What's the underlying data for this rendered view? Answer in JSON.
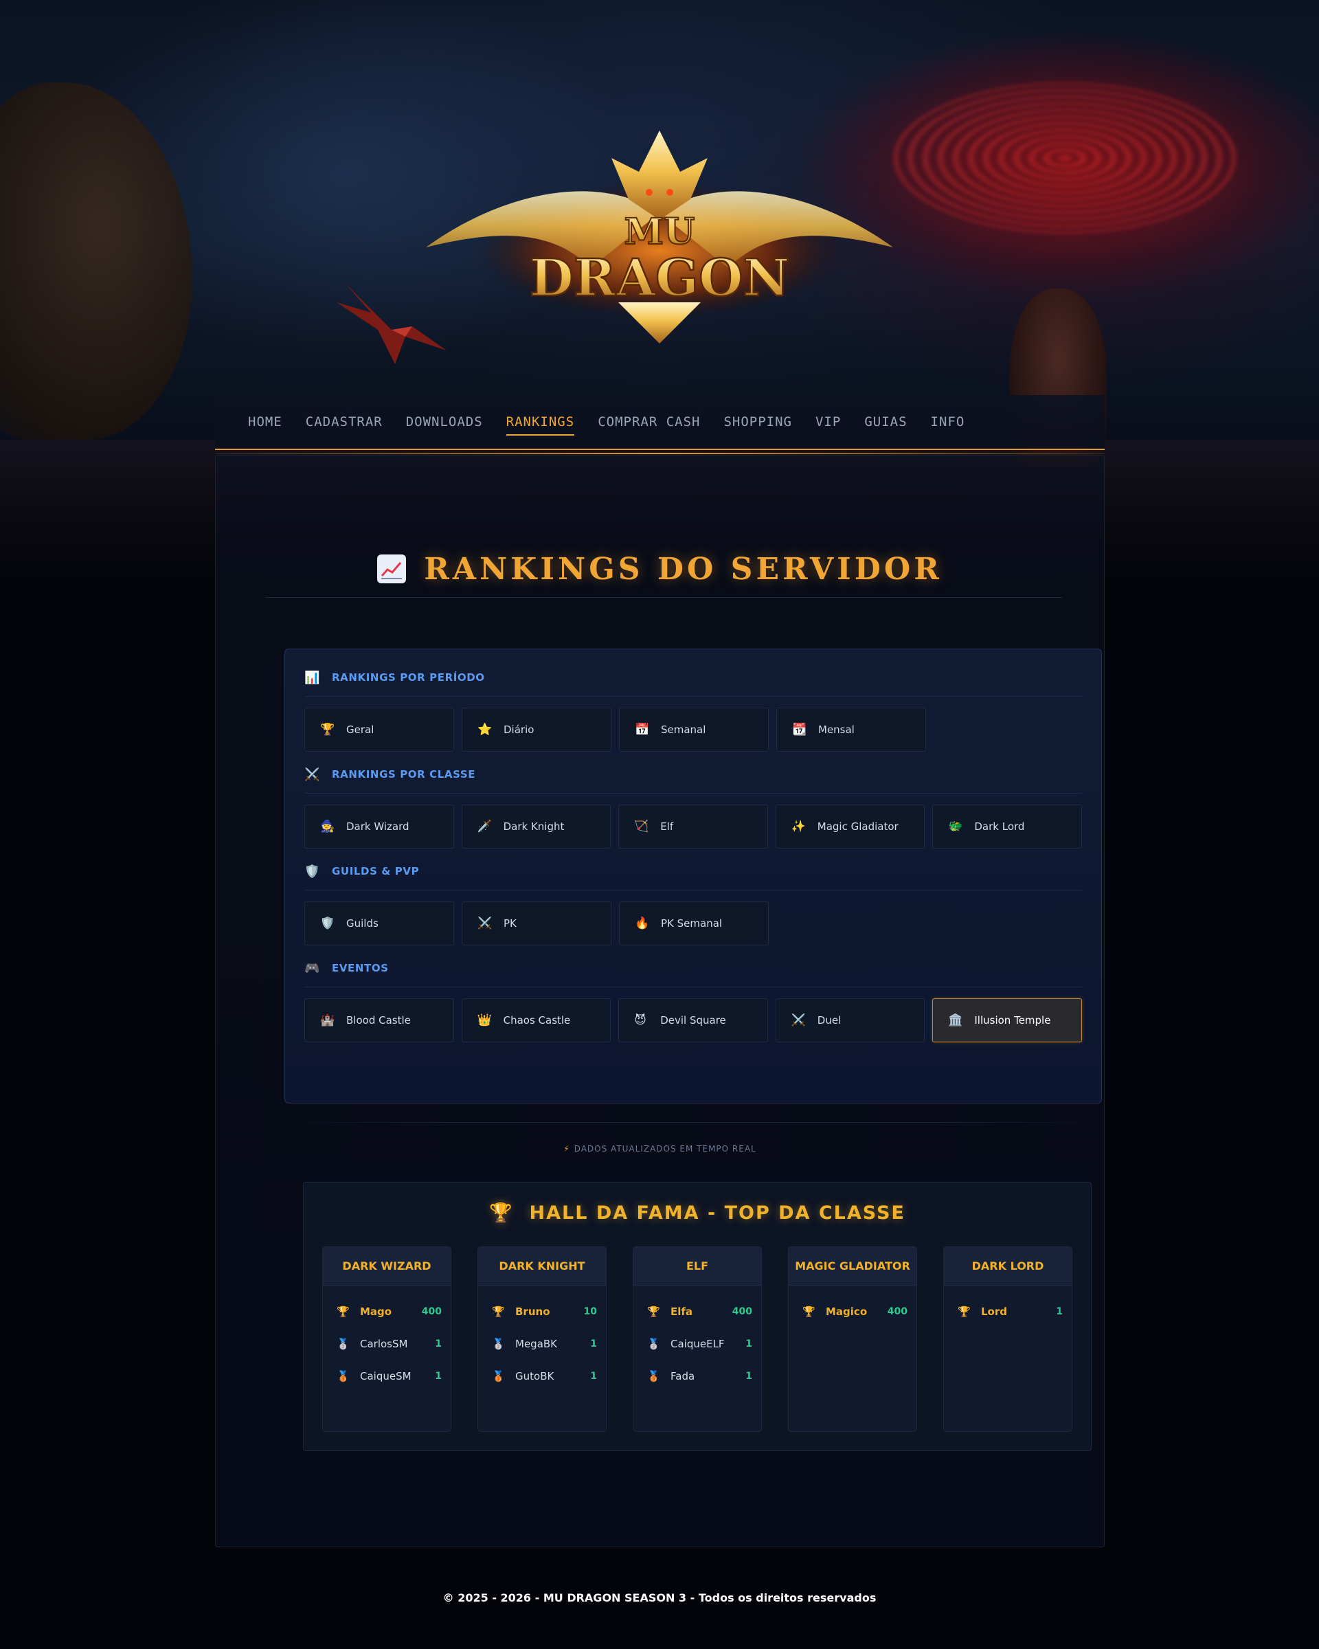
{
  "brand": {
    "logo_line1": "MU",
    "logo_line2": "DRAGON"
  },
  "nav": {
    "items": [
      {
        "label": "HOME"
      },
      {
        "label": "CADASTRAR"
      },
      {
        "label": "DOWNLOADS"
      },
      {
        "label": "RANKINGS",
        "active": true
      },
      {
        "label": "COMPRAR CASH"
      },
      {
        "label": "SHOPPING"
      },
      {
        "label": "VIP"
      },
      {
        "label": "GUIAS"
      },
      {
        "label": "INFO"
      }
    ]
  },
  "page": {
    "title_icon": "chart-up-icon",
    "title": "RANKINGS DO SERVIDOR"
  },
  "categories": {
    "sections": [
      {
        "icon": "📊",
        "icon_name": "bar-chart-icon",
        "label": "RANKINGS POR PERÍODO",
        "buttons": [
          {
            "icon": "🏆",
            "icon_name": "trophy-icon",
            "label": "Geral"
          },
          {
            "icon": "⭐",
            "icon_name": "star-icon",
            "label": "Diário"
          },
          {
            "icon": "📅",
            "icon_name": "calendar-icon",
            "label": "Semanal"
          },
          {
            "icon": "📆",
            "icon_name": "calendar-month-icon",
            "label": "Mensal"
          }
        ]
      },
      {
        "icon": "⚔️",
        "icon_name": "crossed-swords-icon",
        "label": "RANKINGS POR CLASSE",
        "buttons": [
          {
            "icon": "🧙",
            "icon_name": "wizard-icon",
            "label": "Dark Wizard"
          },
          {
            "icon": "🗡️",
            "icon_name": "dagger-icon",
            "label": "Dark Knight"
          },
          {
            "icon": "🏹",
            "icon_name": "bow-arrow-icon",
            "label": "Elf"
          },
          {
            "icon": "✨",
            "icon_name": "sparkles-icon",
            "label": "Magic Gladiator"
          },
          {
            "icon": "🐲",
            "icon_name": "dragon-icon",
            "label": "Dark Lord"
          }
        ]
      },
      {
        "icon": "🛡️",
        "icon_name": "shield-icon",
        "label": "GUILDS & PVP",
        "buttons": [
          {
            "icon": "🛡️",
            "icon_name": "shield-icon",
            "label": "Guilds"
          },
          {
            "icon": "⚔️",
            "icon_name": "crossed-swords-icon",
            "label": "PK"
          },
          {
            "icon": "🔥",
            "icon_name": "fire-icon",
            "label": "PK Semanal"
          }
        ]
      },
      {
        "icon": "🎮",
        "icon_name": "gamepad-icon",
        "label": "EVENTOS",
        "buttons": [
          {
            "icon": "🏰",
            "icon_name": "castle-icon",
            "label": "Blood Castle"
          },
          {
            "icon": "👑",
            "icon_name": "crown-icon",
            "label": "Chaos Castle"
          },
          {
            "icon": "😈",
            "icon_name": "devil-icon",
            "label": "Devil Square"
          },
          {
            "icon": "⚔️",
            "icon_name": "crossed-swords-icon",
            "label": "Duel"
          },
          {
            "icon": "🏛️",
            "icon_name": "temple-icon",
            "label": "Illusion Temple",
            "active": true
          }
        ]
      }
    ]
  },
  "realtime": {
    "icon_name": "lightning-icon",
    "text": "DADOS ATUALIZADOS EM TEMPO REAL"
  },
  "hall_of_fame": {
    "icon_name": "trophy-icon",
    "title": "HALL DA FAMA - TOP DA CLASSE",
    "classes": [
      {
        "name": "DARK WIZARD",
        "players": [
          {
            "rank": 1,
            "medal": "🏆",
            "name": "Mago",
            "value": "400"
          },
          {
            "rank": 2,
            "medal": "🥈",
            "name": "CarlosSM",
            "value": "1"
          },
          {
            "rank": 3,
            "medal": "🥉",
            "name": "CaiqueSM",
            "value": "1"
          }
        ]
      },
      {
        "name": "DARK KNIGHT",
        "players": [
          {
            "rank": 1,
            "medal": "🏆",
            "name": "Bruno",
            "value": "10"
          },
          {
            "rank": 2,
            "medal": "🥈",
            "name": "MegaBK",
            "value": "1"
          },
          {
            "rank": 3,
            "medal": "🥉",
            "name": "GutoBK",
            "value": "1"
          }
        ]
      },
      {
        "name": "ELF",
        "players": [
          {
            "rank": 1,
            "medal": "🏆",
            "name": "Elfa",
            "value": "400"
          },
          {
            "rank": 2,
            "medal": "🥈",
            "name": "CaiqueELF",
            "value": "1"
          },
          {
            "rank": 3,
            "medal": "🥉",
            "name": "Fada",
            "value": "1"
          }
        ]
      },
      {
        "name": "MAGIC GLADIATOR",
        "players": [
          {
            "rank": 1,
            "medal": "🏆",
            "name": "Magico",
            "value": "400"
          }
        ]
      },
      {
        "name": "DARK LORD",
        "players": [
          {
            "rank": 1,
            "medal": "🏆",
            "name": "Lord",
            "value": "1"
          }
        ]
      }
    ]
  },
  "footer": {
    "text": "© 2025 - 2026 - MU DRAGON SEASON 3 - Todos os direitos reservados"
  },
  "colors": {
    "accent_gold": "#f0a534",
    "section_blue": "#5b9bf0",
    "value_green": "#2ec98f",
    "background": "#020409"
  }
}
